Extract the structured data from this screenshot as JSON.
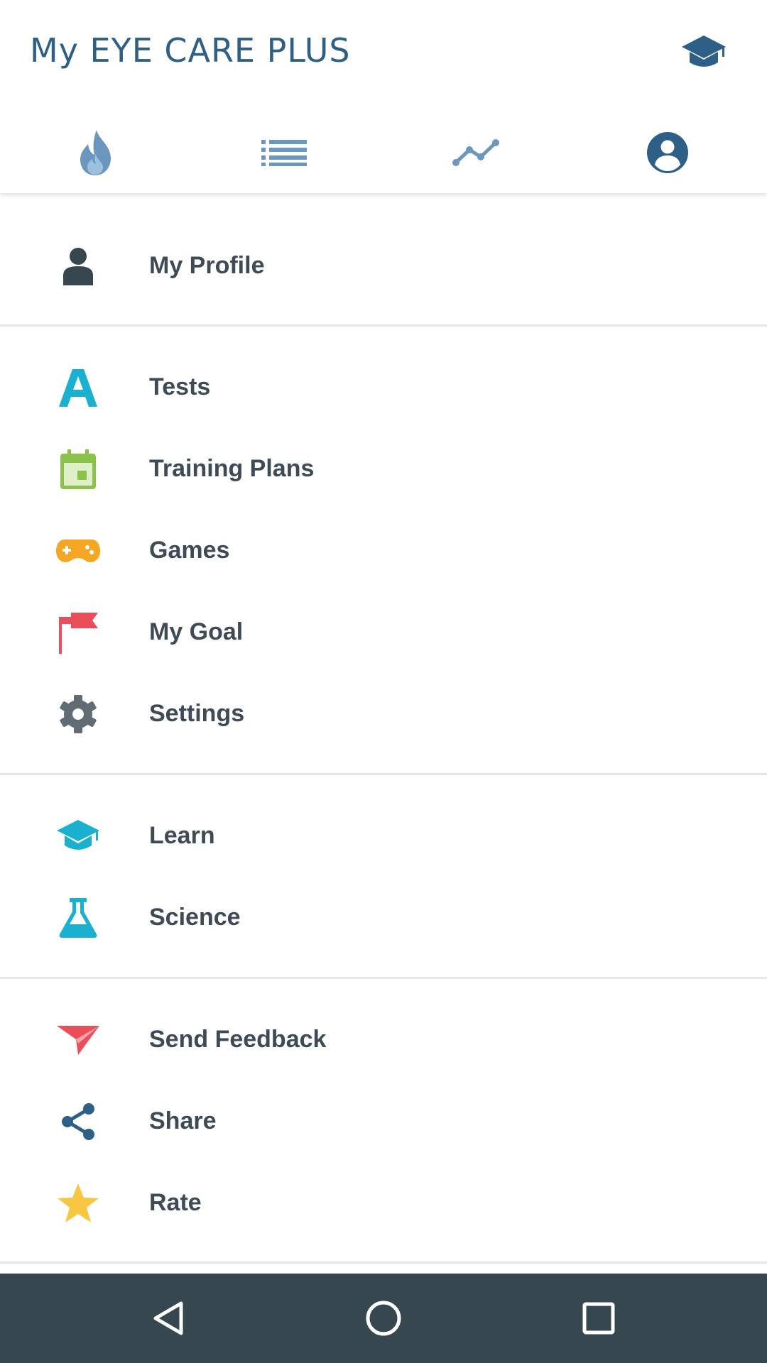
{
  "app": {
    "title": "My EYE CARE PLUS"
  },
  "header": {
    "action_icon": "graduation-cap-icon",
    "tabs": [
      {
        "icon": "flame-icon",
        "active": true
      },
      {
        "icon": "list-icon",
        "active": false
      },
      {
        "icon": "trend-line-icon",
        "active": false
      },
      {
        "icon": "account-circle-icon",
        "active": false
      }
    ]
  },
  "menu": {
    "profile": {
      "label": "My Profile",
      "icon": "person-icon"
    },
    "tests": {
      "label": "Tests",
      "icon": "letter-a-icon"
    },
    "training_plans": {
      "label": "Training Plans",
      "icon": "calendar-icon"
    },
    "games": {
      "label": "Games",
      "icon": "gamepad-icon"
    },
    "my_goal": {
      "label": "My Goal",
      "icon": "flag-icon"
    },
    "settings": {
      "label": "Settings",
      "icon": "gear-icon"
    },
    "learn": {
      "label": "Learn",
      "icon": "graduation-cap-icon"
    },
    "science": {
      "label": "Science",
      "icon": "flask-icon"
    },
    "send_feedback": {
      "label": "Send Feedback",
      "icon": "paper-plane-icon"
    },
    "share": {
      "label": "Share",
      "icon": "share-icon"
    },
    "rate": {
      "label": "Rate",
      "icon": "star-icon"
    }
  },
  "navbar": {
    "buttons": [
      "back-icon",
      "home-icon",
      "recents-icon"
    ]
  },
  "colors": {
    "brand": "#2e5f86",
    "label": "#3e4a55",
    "teal": "#1ab0cf",
    "green": "#8bc34a",
    "orange": "#f5a623",
    "red": "#e94e5a",
    "gray": "#616b73",
    "yellow": "#f7c744",
    "navbar": "#37474f"
  }
}
